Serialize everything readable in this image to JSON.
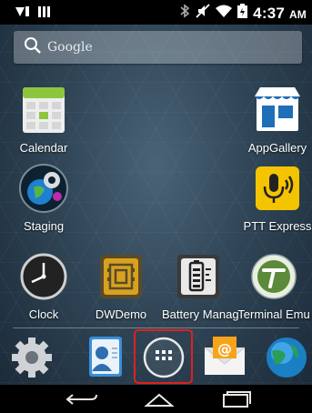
{
  "status_bar": {
    "time": "4:37",
    "ampm": "AM",
    "icons": [
      "vibrate-icon",
      "signal-bars-icon",
      "bluetooth-icon",
      "mute-icon",
      "wifi-icon",
      "battery-icon"
    ]
  },
  "search": {
    "placeholder": "Google",
    "icon": "search-icon"
  },
  "apps": [
    {
      "label": "Calendar",
      "icon": "calendar-icon"
    },
    {
      "label": "AppGallery",
      "icon": "store-icon"
    },
    {
      "label": "Staging",
      "icon": "globe-staging-icon"
    },
    {
      "label": "PTT Express",
      "icon": "ptt-icon",
      "color": "#f5c400"
    },
    {
      "label": "Clock",
      "icon": "clock-icon"
    },
    {
      "label": "DWDemo",
      "icon": "barcode-icon",
      "color": "#d8a21e"
    },
    {
      "label": "Battery Manag",
      "icon": "battery-manager-icon"
    },
    {
      "label": "Terminal Emu",
      "icon": "terminal-icon",
      "color": "#5a8a3a"
    }
  ],
  "dock": [
    {
      "name": "settings",
      "icon": "gear-icon"
    },
    {
      "name": "contacts",
      "icon": "contacts-icon"
    },
    {
      "name": "app-drawer",
      "icon": "app-drawer-icon",
      "highlighted": true
    },
    {
      "name": "email",
      "icon": "email-icon"
    },
    {
      "name": "browser",
      "icon": "browser-globe-icon"
    }
  ],
  "nav": [
    "back-icon",
    "home-icon",
    "recents-icon"
  ],
  "highlight_color": "#e02020"
}
